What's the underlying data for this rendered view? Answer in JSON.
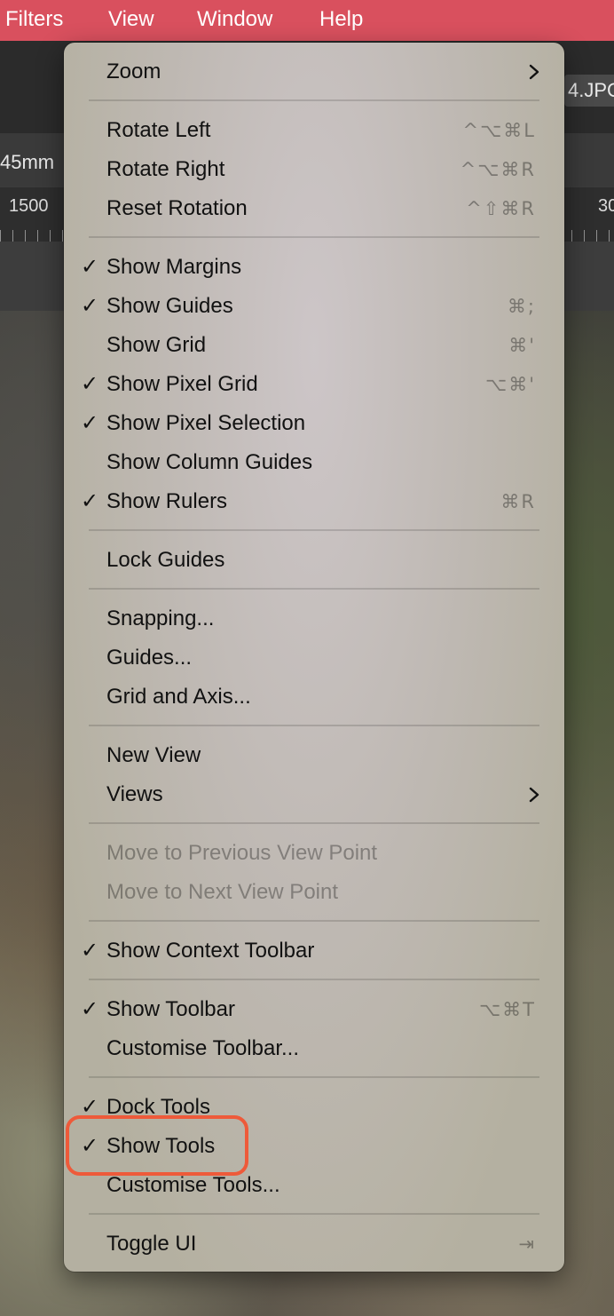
{
  "menubar": {
    "items": [
      "Filters",
      "View",
      "Window",
      "Help"
    ]
  },
  "document": {
    "file_label": "4.JPG",
    "units": "45mm",
    "ruler_left": "1500",
    "ruler_right": "30"
  },
  "menu": {
    "zoom": "Zoom",
    "rotate_left": "Rotate Left",
    "rotate_left_shortcut": "^⌥⌘L",
    "rotate_right": "Rotate Right",
    "rotate_right_shortcut": "^⌥⌘R",
    "reset_rotation": "Reset Rotation",
    "reset_rotation_shortcut": "^⇧⌘R",
    "show_margins": "Show Margins",
    "show_guides": "Show Guides",
    "show_guides_shortcut": "⌘;",
    "show_grid": "Show Grid",
    "show_grid_shortcut": "⌘'",
    "show_pixel_grid": "Show Pixel Grid",
    "show_pixel_grid_shortcut": "⌥⌘'",
    "show_pixel_selection": "Show Pixel Selection",
    "show_column_guides": "Show Column Guides",
    "show_rulers": "Show Rulers",
    "show_rulers_shortcut": "⌘R",
    "lock_guides": "Lock Guides",
    "snapping": "Snapping...",
    "guides": "Guides...",
    "grid_and_axis": "Grid and Axis...",
    "new_view": "New View",
    "views": "Views",
    "move_prev_view_point": "Move to Previous View Point",
    "move_next_view_point": "Move to Next View Point",
    "show_context_toolbar": "Show Context Toolbar",
    "show_toolbar": "Show Toolbar",
    "show_toolbar_shortcut": "⌥⌘T",
    "customise_toolbar": "Customise Toolbar...",
    "dock_tools": "Dock Tools",
    "show_tools": "Show Tools",
    "customise_tools": "Customise Tools...",
    "toggle_ui": "Toggle UI",
    "toggle_ui_shortcut": "⇥",
    "check_glyph": "✓"
  },
  "colors": {
    "menubar": "#d9505e",
    "highlight_ring": "#ee5a3a"
  }
}
